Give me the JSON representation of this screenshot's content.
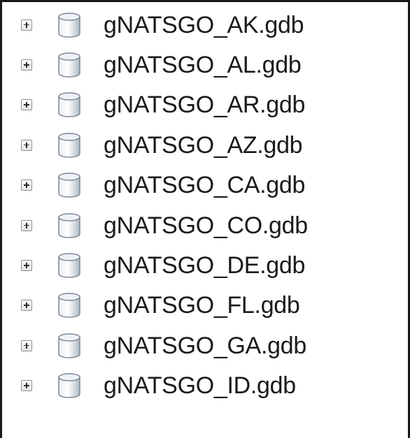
{
  "tree": {
    "items": [
      {
        "label": "gNATSGO_AK.gdb",
        "icon": "database-icon"
      },
      {
        "label": "gNATSGO_AL.gdb",
        "icon": "database-icon"
      },
      {
        "label": "gNATSGO_AR.gdb",
        "icon": "database-icon"
      },
      {
        "label": "gNATSGO_AZ.gdb",
        "icon": "database-icon"
      },
      {
        "label": "gNATSGO_CA.gdb",
        "icon": "database-icon"
      },
      {
        "label": "gNATSGO_CO.gdb",
        "icon": "database-icon"
      },
      {
        "label": "gNATSGO_DE.gdb",
        "icon": "database-icon"
      },
      {
        "label": "gNATSGO_FL.gdb",
        "icon": "database-icon"
      },
      {
        "label": "gNATSGO_GA.gdb",
        "icon": "database-icon"
      },
      {
        "label": "gNATSGO_ID.gdb",
        "icon": "database-icon"
      }
    ]
  },
  "colors": {
    "text": "#1a1a1a",
    "icon_fill": "#c9d1dc",
    "icon_stroke": "#7d8794",
    "border": "#1a1a1a"
  }
}
